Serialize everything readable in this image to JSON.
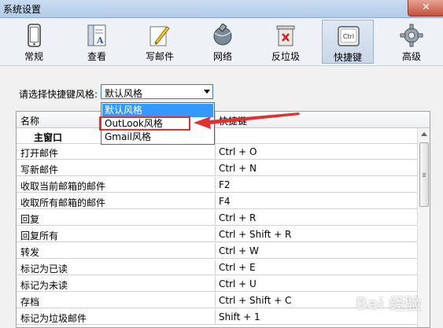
{
  "window": {
    "title": "系统设置",
    "close_label": "✕"
  },
  "toolbar": [
    {
      "label": "常规",
      "icon": "phone-icon"
    },
    {
      "label": "查看",
      "icon": "document-view-icon"
    },
    {
      "label": "写邮件",
      "icon": "pencil-paper-icon"
    },
    {
      "label": "网络",
      "icon": "satellite-globe-icon"
    },
    {
      "label": "反垃圾",
      "icon": "trash-reject-icon"
    },
    {
      "label": "快捷键",
      "icon": "ctrl-key-icon",
      "key_text": "Ctrl",
      "active": true
    },
    {
      "label": "高级",
      "icon": "gear-icon"
    }
  ],
  "shortcut_style": {
    "prompt": "请选择快捷键风格:",
    "selected": "默认风格",
    "options": [
      "默认风格",
      "OutLook风格",
      "Gmail风格"
    ]
  },
  "table": {
    "headers": [
      "名称",
      "快捷键"
    ],
    "rows": [
      {
        "name": "主窗口",
        "key": "",
        "group": true
      },
      {
        "name": "打开邮件",
        "key": "Ctrl + O"
      },
      {
        "name": "写新邮件",
        "key": "Ctrl + N"
      },
      {
        "name": "收取当前邮箱的邮件",
        "key": "F2"
      },
      {
        "name": "收取所有邮箱的邮件",
        "key": "F4"
      },
      {
        "name": "回复",
        "key": "Ctrl + R"
      },
      {
        "name": "回复所有",
        "key": "Ctrl + Shift + R"
      },
      {
        "name": "转发",
        "key": "Ctrl + W"
      },
      {
        "name": "标记为已读",
        "key": "Ctrl + E"
      },
      {
        "name": "标记为未读",
        "key": "Ctrl + U"
      },
      {
        "name": "存档",
        "key": "Ctrl + Shift + C"
      },
      {
        "name": "标记为垃圾邮件",
        "key": "Shift + 1"
      }
    ]
  },
  "colors": {
    "highlight": "#3399ff",
    "annotation": "#e03030"
  }
}
